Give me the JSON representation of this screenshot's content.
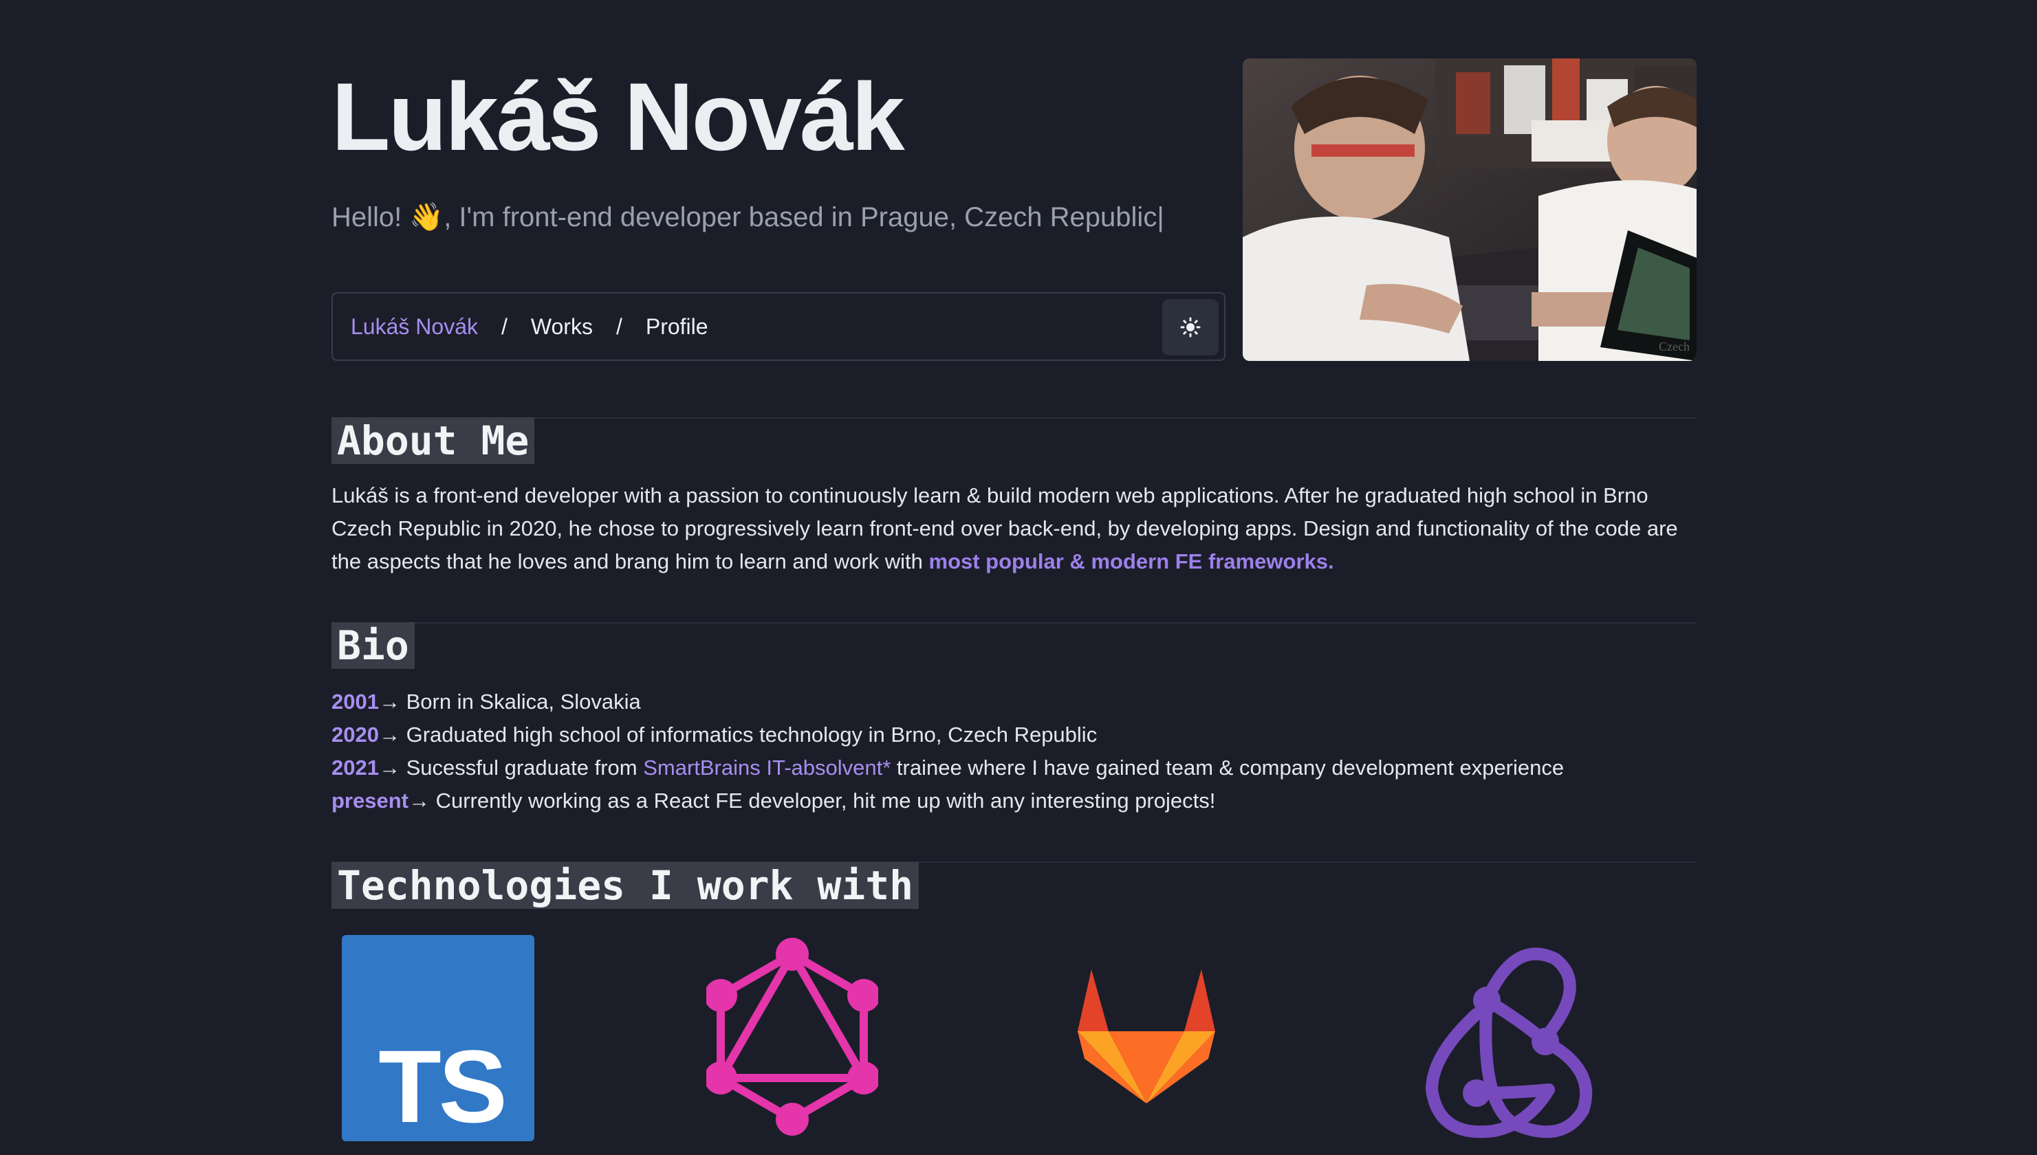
{
  "header": {
    "name": "Lukáš Novák",
    "greeting": "Hello! ",
    "wave_emoji": "👋",
    "tagline": ", I'm front-end developer based in Prague, Czech Republic",
    "caret": "|"
  },
  "nav": {
    "items": [
      {
        "label": "Lukáš Novák"
      },
      {
        "label": "Works"
      },
      {
        "label": "Profile"
      }
    ],
    "separator": "/",
    "theme_toggle_icon": "sun-icon"
  },
  "about": {
    "heading": "About Me",
    "text": "Lukáš is a front-end developer with a passion to continuously learn & build modern web applications. After he graduated high school in Brno Czech Republic in 2020, he chose to progressively learn front-end over back-end, by developing apps. Design and functionality of the code are the aspects that he loves and brang him to learn and work with ",
    "link": "most popular & modern FE frameworks."
  },
  "bio": {
    "heading": "Bio",
    "arrow": "→",
    "entries": [
      {
        "year": "2001",
        "text": " Born in Skalica, Slovakia"
      },
      {
        "year": "2020",
        "text": " Graduated high school of informatics technology in Brno, Czech Republic"
      },
      {
        "year": "2021",
        "text_before": " Sucessful graduate from ",
        "link": "SmartBrains IT-absolvent*",
        "text_after": " trainee where I have gained team & company development experience"
      },
      {
        "year": "present",
        "text": " Currently working as a React FE developer, hit me up with any interesting projects!"
      }
    ]
  },
  "technologies": {
    "heading": "Technologies I work with",
    "items": [
      {
        "name": "TypeScript",
        "icon": "typescript-icon",
        "label": "TS",
        "color": "#3178c6"
      },
      {
        "name": "GraphQL",
        "icon": "graphql-icon",
        "color": "#e535ab"
      },
      {
        "name": "GitLab",
        "icon": "gitlab-icon",
        "color": "#fc6d26"
      },
      {
        "name": "Redux",
        "icon": "redux-icon",
        "color": "#764abc"
      }
    ]
  },
  "colors": {
    "background": "#1b1e29",
    "accent": "#a88ef0"
  }
}
